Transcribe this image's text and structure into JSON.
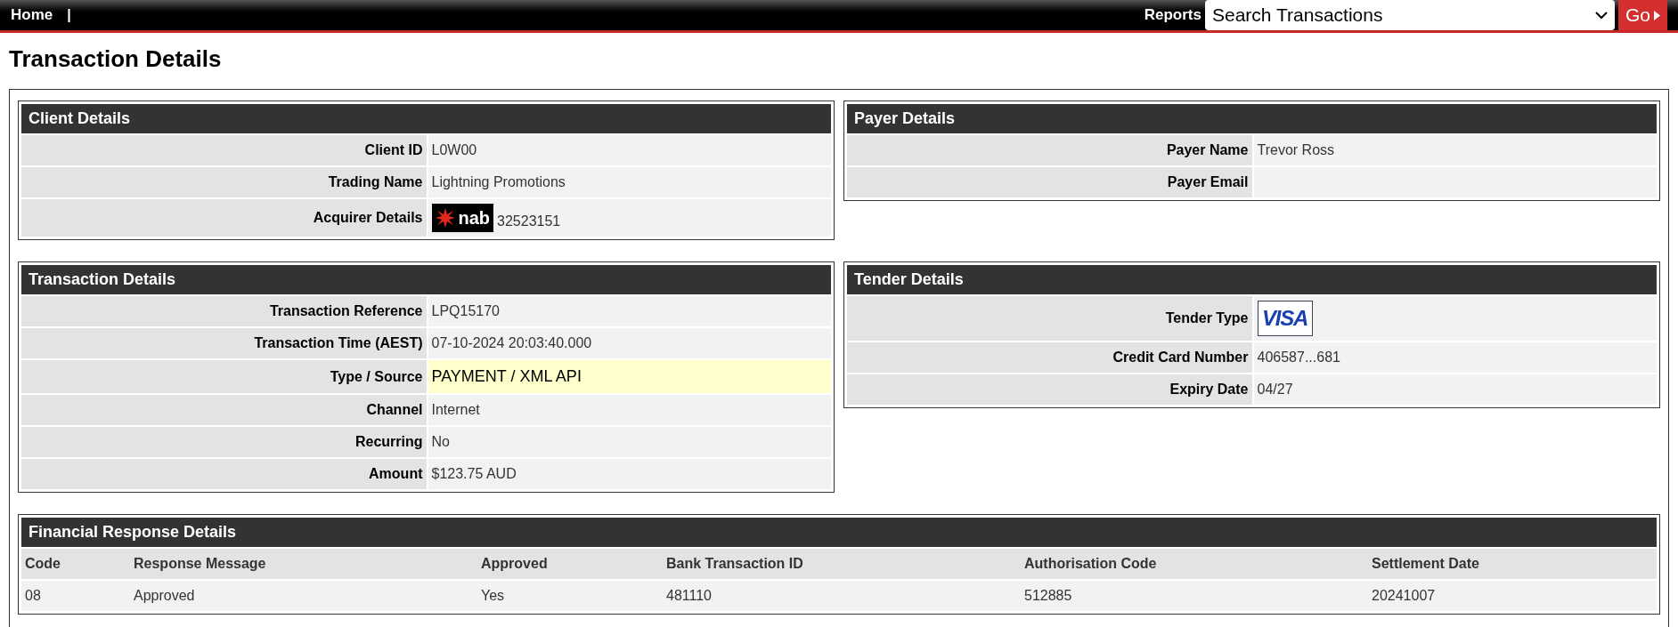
{
  "top_bar": {
    "home_link": "Home",
    "separator": "|",
    "reports_label": "Reports",
    "report_select": "Search Transactions",
    "go_button": "Go"
  },
  "page_title": "Transaction Details",
  "client_details": {
    "title": "Client Details",
    "rows": [
      {
        "kind": "text",
        "label": "Client ID",
        "value": "L0W00",
        "highlighted": false
      },
      {
        "kind": "text",
        "label": "Trading Name",
        "value": "Lightning Promotions",
        "highlighted": false
      },
      {
        "kind": "nab_logo",
        "label": "Acquirer Details",
        "logo": "nab",
        "value": "32523151",
        "highlighted": false
      }
    ]
  },
  "payer_details": {
    "title": "Payer Details",
    "rows": [
      {
        "kind": "text",
        "label": "Payer Name",
        "value": "Trevor Ross",
        "highlighted": false
      },
      {
        "kind": "text",
        "label": "Payer Email",
        "highlighted": false
      }
    ]
  },
  "transaction_details": {
    "title": "Transaction Details",
    "rows": [
      {
        "kind": "text",
        "label": "Transaction Reference",
        "value": "LPQ15170",
        "highlighted": false
      },
      {
        "kind": "text",
        "label": "Transaction Time (AEST)",
        "value": "07-10-2024 20:03:40.000",
        "highlighted": false
      },
      {
        "kind": "text",
        "label": "Type / Source",
        "value": "PAYMENT / XML API",
        "highlighted": true
      },
      {
        "kind": "text",
        "label": "Channel",
        "value": "Internet",
        "highlighted": false
      },
      {
        "kind": "text",
        "label": "Recurring",
        "value": "No",
        "highlighted": false
      },
      {
        "kind": "text",
        "label": "Amount",
        "value": "$123.75 AUD",
        "highlighted": false
      }
    ]
  },
  "tender_details": {
    "title": "Tender Details",
    "rows": [
      {
        "kind": "visa_logo",
        "label": "Tender Type",
        "logo": "VISA",
        "highlighted": false
      },
      {
        "kind": "text",
        "label": "Credit Card Number",
        "value": "406587...681",
        "highlighted": false
      },
      {
        "kind": "text",
        "label": "Expiry Date",
        "value": "04/27",
        "highlighted": false
      }
    ]
  },
  "financial_response_details": {
    "title": "Financial Response Details",
    "columns": [
      "Code",
      "Response Message",
      "Approved",
      "Bank Transaction ID",
      "Authorisation Code",
      "Settlement Date"
    ],
    "rows": [
      [
        "08",
        "Approved",
        "Yes",
        "481110",
        "512885",
        "20241007"
      ]
    ]
  }
}
